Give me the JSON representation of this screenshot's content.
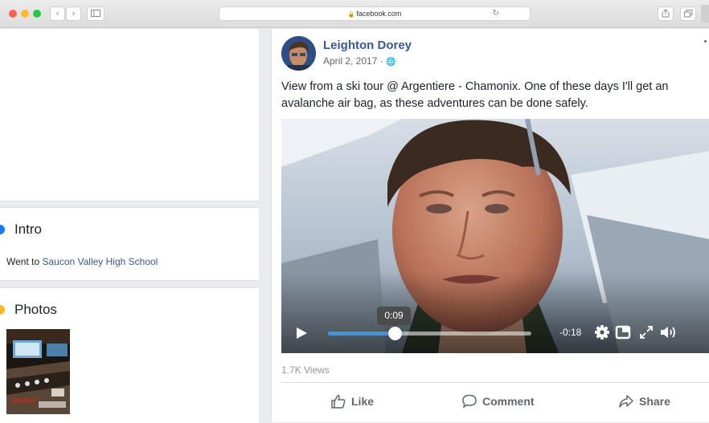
{
  "browser": {
    "url": "facebook.com",
    "traffic_lights": [
      "#ff5f57",
      "#febc2e",
      "#28c840"
    ]
  },
  "intro": {
    "title": "Intro",
    "went_to_prefix": "Went to",
    "school": "Saucon Valley High School"
  },
  "photos": {
    "title": "Photos"
  },
  "post": {
    "author": "Leighton Dorey",
    "date": "April 2, 2017 ·",
    "text": "View from a ski tour @ Argentiere - Chamonix. One of these days I'll get an avalanche air bag, as these adventures can be done safely.",
    "views": "1.7K Views"
  },
  "video": {
    "current_time": "0:09",
    "remaining_time": "-0:18",
    "progress": 0.33
  },
  "actions": {
    "like": "Like",
    "comment": "Comment",
    "share": "Share"
  },
  "colors": {
    "link_blue": "#385898",
    "progress_blue": "#4a90e2",
    "intro_accent": "#1877f2",
    "photos_accent": "#f7b928"
  }
}
